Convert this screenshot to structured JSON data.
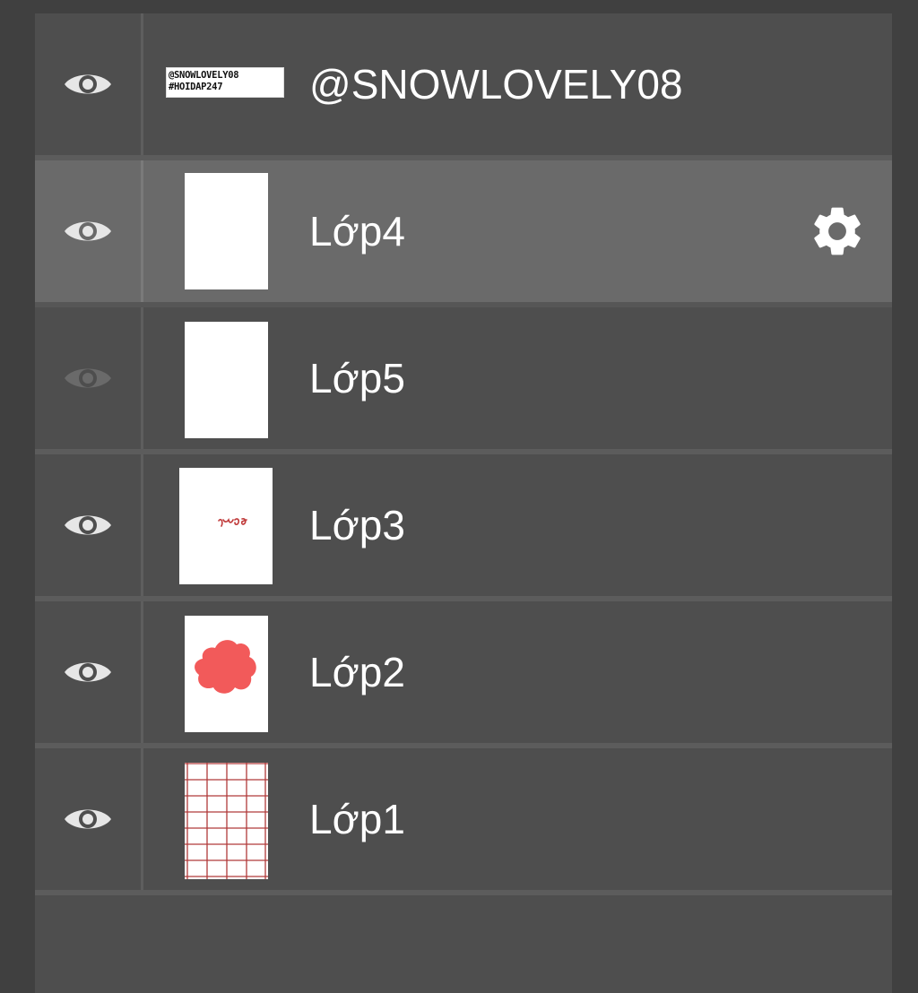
{
  "layers": [
    {
      "id": "text",
      "name": "@SNOWLOVELY08",
      "visible": true,
      "selected": false,
      "thumbnail_kind": "text",
      "thumbnail_lines": [
        "@SNOWLOVELY08",
        "#HOIDAP247"
      ]
    },
    {
      "id": "lop4",
      "name": "Lớp4",
      "visible": true,
      "selected": true,
      "thumbnail_kind": "blank"
    },
    {
      "id": "lop5",
      "name": "Lớp5",
      "visible": false,
      "selected": false,
      "thumbnail_kind": "blank"
    },
    {
      "id": "lop3",
      "name": "Lớp3",
      "visible": true,
      "selected": false,
      "thumbnail_kind": "scribble"
    },
    {
      "id": "lop2",
      "name": "Lớp2",
      "visible": true,
      "selected": false,
      "thumbnail_kind": "red-blob"
    },
    {
      "id": "lop1",
      "name": "Lớp1",
      "visible": true,
      "selected": false,
      "thumbnail_kind": "grid"
    }
  ],
  "icons": {
    "visibility": "eye-icon",
    "settings": "gear-icon"
  },
  "colors": {
    "panel": "#4e4e4e",
    "selected_row": "#6a6a6a",
    "eye_visible": "#e6e6e6",
    "eye_hidden": "#6a6a6a",
    "blob_red": "#f25a5a",
    "grid_red": "#b03a3a"
  }
}
